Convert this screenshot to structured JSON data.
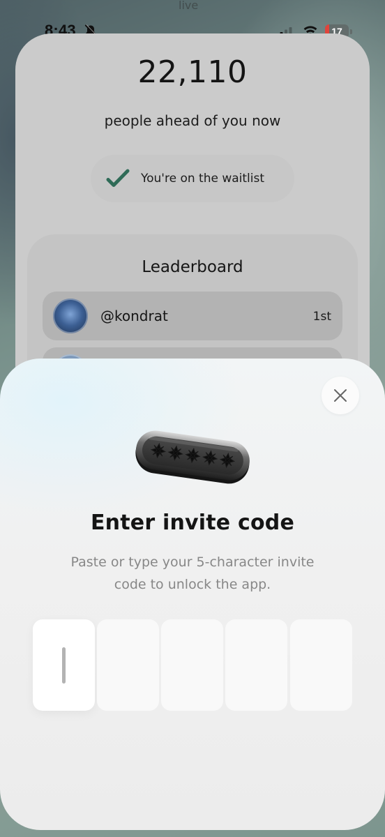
{
  "status_bar": {
    "time": "8:43",
    "battery_level": "17",
    "battery_fraction": 0.17,
    "battery_color": "#e0453c",
    "icons": [
      "bell-slash-icon",
      "cellular-signal-icon",
      "wifi-icon",
      "battery-icon"
    ]
  },
  "background_peek": {
    "text": "live"
  },
  "waitlist": {
    "count": "22,110",
    "count_label": "people ahead of you now",
    "status_text": "You're on the waitlist",
    "status_icon": "checkmark-icon",
    "check_color": "#2f6b57"
  },
  "leaderboard": {
    "title": "Leaderboard",
    "rows": [
      {
        "handle": "@kondrat",
        "rank": "1st"
      }
    ]
  },
  "invite_sheet": {
    "close_icon": "close-icon",
    "badge_icon": "invite-code-badge-icon",
    "title": "Enter invite code",
    "description": "Paste or type your 5-character invite code to unlock the app.",
    "code_length": 5,
    "code_values": [
      "",
      "",
      "",
      "",
      ""
    ],
    "active_slot": 1
  }
}
